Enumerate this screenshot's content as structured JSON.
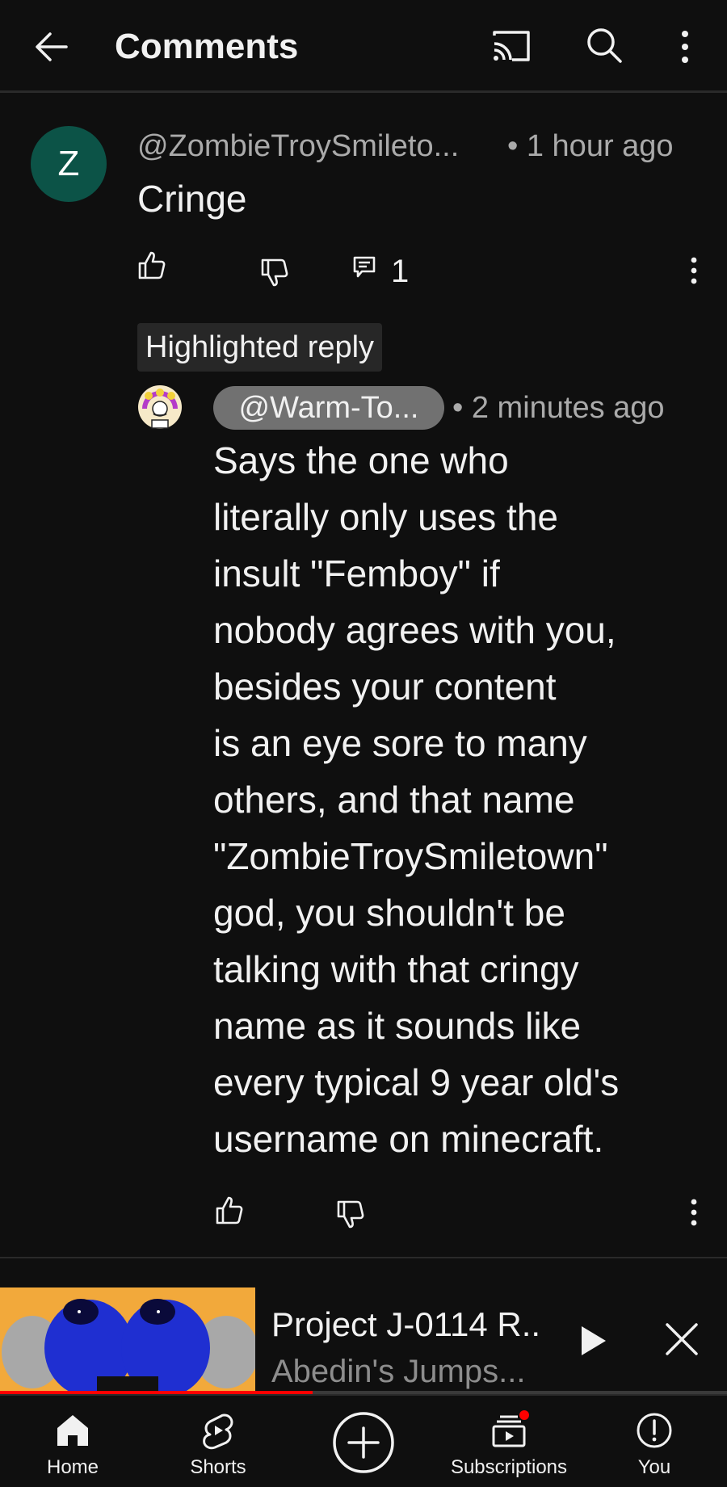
{
  "header": {
    "back_icon": "arrow-left-icon",
    "title": "Comments",
    "cast_icon": "cast-icon",
    "search_icon": "search-icon",
    "more_icon": "more-vertical-icon"
  },
  "comment": {
    "avatar_letter": "Z",
    "avatar_color": "#0c5347",
    "author": "@ZombieTroySmileto...",
    "time": "• 1 hour ago",
    "text": "Cringe",
    "reply_count": "1",
    "highlight_label": "Highlighted reply"
  },
  "reply": {
    "author": "@Warm-To...",
    "time": "• 2 minutes ago",
    "text_lines": [
      "Says the one who",
      "literally only uses the",
      "insult \"Femboy\" if",
      "nobody agrees with you,",
      "besides your content",
      "is an eye sore to many",
      "others, and that name",
      "\"ZombieTroySmiletown\"",
      "god, you shouldn't be",
      "talking with that cringy",
      "name as it sounds like",
      "every typical 9 year old's",
      "username on minecraft."
    ]
  },
  "mini_player": {
    "title": "Project J-0114 R..",
    "channel": "Abedin's Jumps...",
    "progress_fraction": 0.43,
    "accent_color": "#ff0000"
  },
  "nav": {
    "home": "Home",
    "shorts": "Shorts",
    "subscriptions": "Subscriptions",
    "you": "You",
    "create_icon": "create-plus-icon"
  }
}
